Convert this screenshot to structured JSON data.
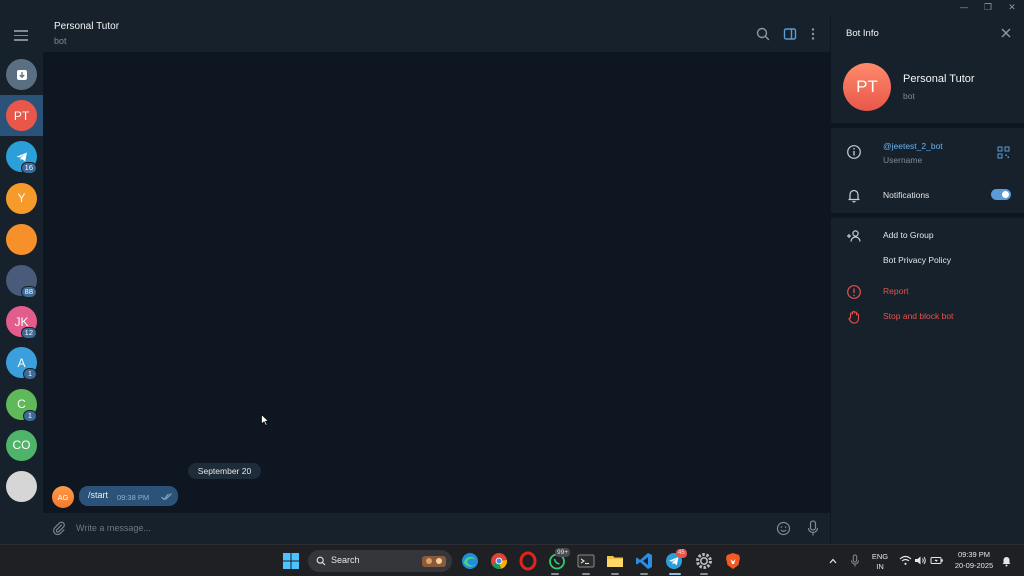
{
  "window": {
    "minimize": "—",
    "maximize": "❐",
    "close": "✕"
  },
  "chat_list": [
    {
      "id": "archive",
      "initials": "",
      "color": "#5b6f82",
      "badge": ""
    },
    {
      "id": "pt",
      "initials": "PT",
      "color": "#e8574a",
      "badge": "",
      "active": true
    },
    {
      "id": "telegram",
      "initials": "",
      "color": "#2a9fd8",
      "badge": "16"
    },
    {
      "id": "y",
      "initials": "Y",
      "color": "#f59a2b",
      "badge": ""
    },
    {
      "id": "orange",
      "initials": "",
      "color": "#f5902b",
      "badge": ""
    },
    {
      "id": "photo1",
      "initials": "",
      "color": "#4a5a7a",
      "badge": "88"
    },
    {
      "id": "jk",
      "initials": "JK",
      "color": "#e35d8c",
      "badge": "12"
    },
    {
      "id": "a",
      "initials": "A",
      "color": "#3a9fdc",
      "badge": "1"
    },
    {
      "id": "c",
      "initials": "C",
      "color": "#5fb85a",
      "badge": "1"
    },
    {
      "id": "co",
      "initials": "CO",
      "color": "#4fb36a",
      "badge": ""
    },
    {
      "id": "photo2",
      "initials": "",
      "color": "#d6d6d6",
      "badge": ""
    }
  ],
  "chat": {
    "title": "Personal Tutor",
    "subtitle": "bot",
    "date": "September 20",
    "message": {
      "avatar": "AG",
      "text": "/start",
      "time": "09:38 PM"
    },
    "input_placeholder": "Write a message..."
  },
  "panel": {
    "title": "Bot Info",
    "avatar": "PT",
    "name": "Personal Tutor",
    "subtitle": "bot",
    "username": "@jeetest_2_bot",
    "username_label": "Username",
    "notifications": "Notifications",
    "notifications_on": true,
    "add_to_group": "Add to Group",
    "privacy_policy": "Bot Privacy Policy",
    "report": "Report",
    "stop_block": "Stop and block bot"
  },
  "taskbar": {
    "search": "Search",
    "whatsapp_badge": "99+",
    "telegram_badge": "45",
    "lang_top": "ENG",
    "lang_bottom": "IN",
    "time": "09:39 PM",
    "date": "20-09-2025"
  }
}
